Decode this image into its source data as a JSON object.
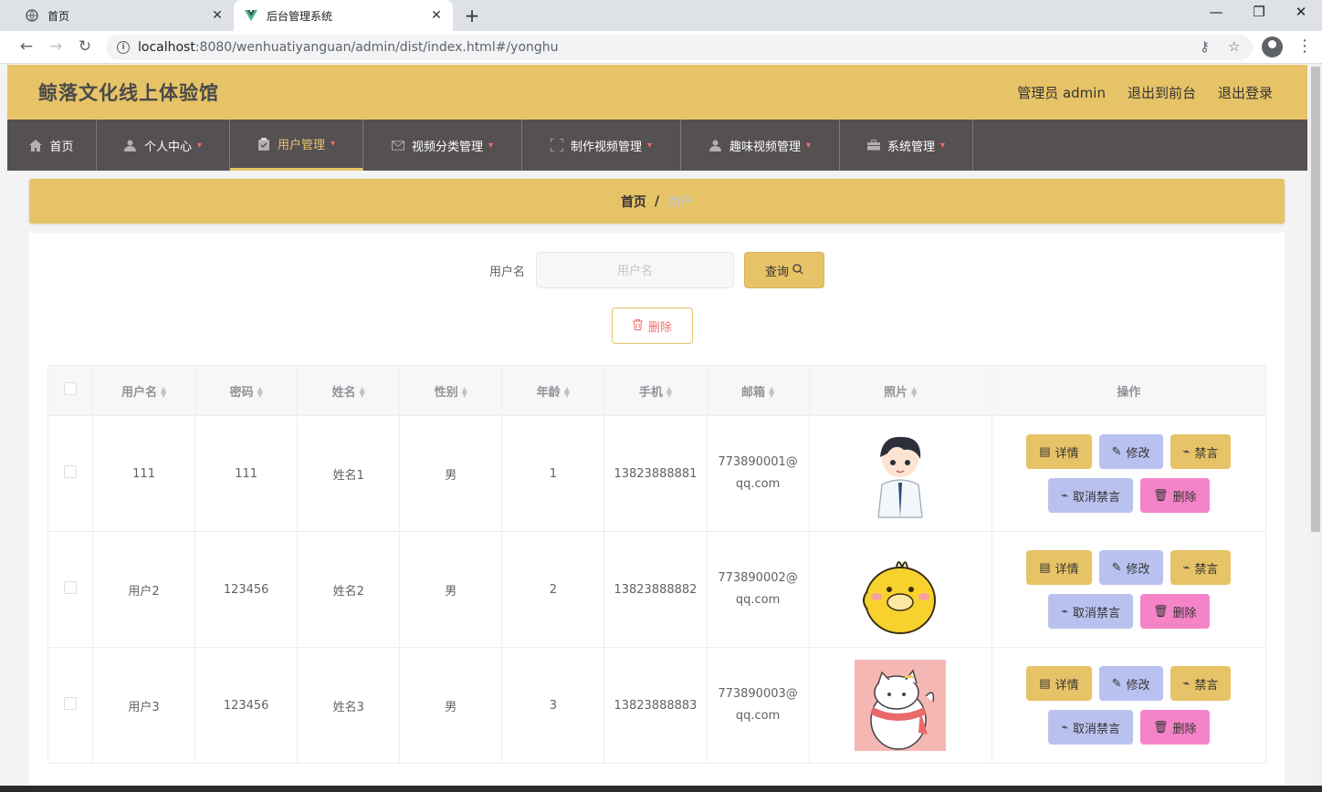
{
  "browser": {
    "tabs": [
      {
        "title": "首页"
      },
      {
        "title": "后台管理系统"
      }
    ],
    "url_host": "localhost",
    "url_rest": ":8080/wenhuatiyanguan/admin/dist/index.html#/yonghu"
  },
  "header": {
    "site_title": "鲸落文化线上体验馆",
    "admin_label": "管理员 admin",
    "front_link": "退出到前台",
    "logout_link": "退出登录"
  },
  "nav": {
    "items": [
      {
        "label": "首页",
        "icon": "home-icon"
      },
      {
        "label": "个人中心",
        "icon": "user-icon"
      },
      {
        "label": "用户管理",
        "icon": "clipboard-icon"
      },
      {
        "label": "视频分类管理",
        "icon": "mail-icon"
      },
      {
        "label": "制作视频管理",
        "icon": "fullscreen-icon"
      },
      {
        "label": "趣味视频管理",
        "icon": "user-icon"
      },
      {
        "label": "系统管理",
        "icon": "briefcase-icon"
      }
    ]
  },
  "breadcrumb": {
    "home": "首页",
    "separator": "/",
    "current": "用户"
  },
  "search": {
    "label": "用户名",
    "placeholder": "用户名",
    "query_label": "查询"
  },
  "delete_batch_label": "删除",
  "table": {
    "headers": [
      "用户名",
      "密码",
      "姓名",
      "性别",
      "年龄",
      "手机",
      "邮箱",
      "照片",
      "操作"
    ],
    "rows": [
      {
        "username": "111",
        "password": "111",
        "name": "姓名1",
        "gender": "男",
        "age": "1",
        "phone": "13823888881",
        "email_1": "773890001@",
        "email_2": "qq.com",
        "photo": "boy-doctor-cartoon"
      },
      {
        "username": "用户2",
        "password": "123456",
        "name": "姓名2",
        "gender": "男",
        "age": "2",
        "phone": "13823888882",
        "email_1": "773890002@",
        "email_2": "qq.com",
        "photo": "yellow-duck-cartoon"
      },
      {
        "username": "用户3",
        "password": "123456",
        "name": "姓名3",
        "gender": "男",
        "age": "3",
        "phone": "13823888883",
        "email_1": "773890003@",
        "email_2": "qq.com",
        "photo": "white-cat-cartoon"
      }
    ],
    "ops": {
      "detail": "详情",
      "edit": "修改",
      "ban": "禁言",
      "unban": "取消禁言",
      "delete": "删除"
    }
  },
  "colors": {
    "header_bg": "#e7c367",
    "nav_bg": "#555051",
    "pink_button": "#f484c7",
    "lavender_button": "#b9c2ef",
    "danger_text": "#f56c6c"
  }
}
